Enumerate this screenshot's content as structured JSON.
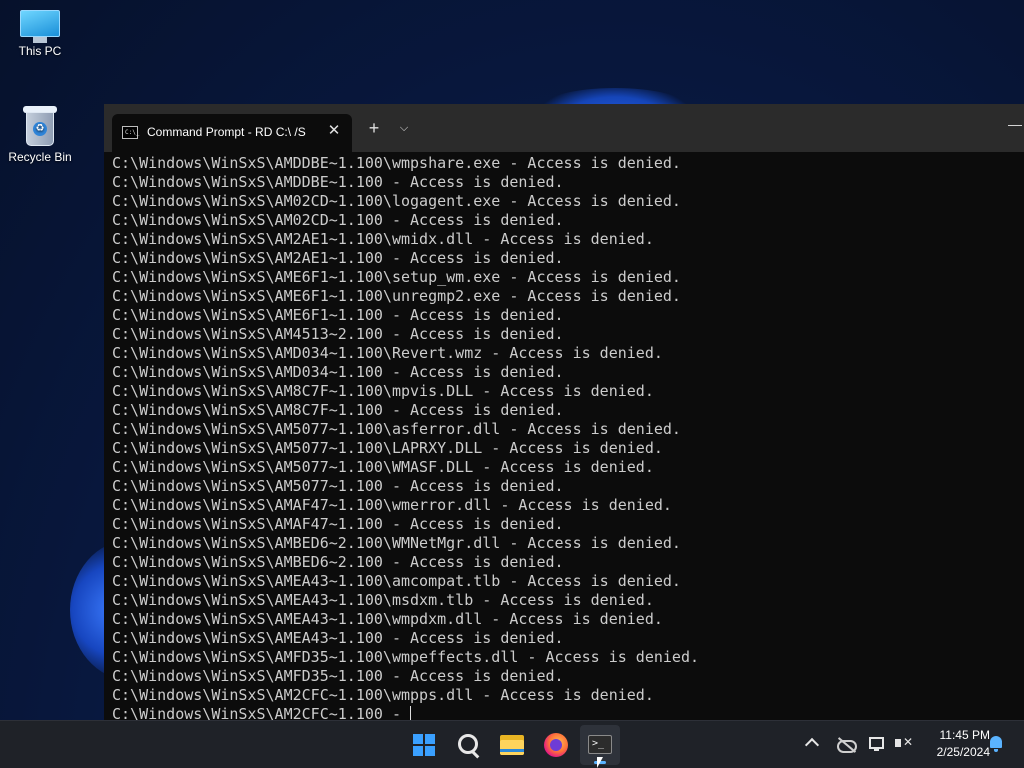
{
  "desktop": {
    "icons": [
      {
        "label": "This PC",
        "icon": "this-pc-icon"
      },
      {
        "label": "Recycle Bin",
        "icon": "recycle-bin-icon"
      }
    ]
  },
  "window": {
    "tab_title": "Command Prompt - RD  C:\\ /S",
    "tab_close": "✕",
    "new_tab": "+",
    "dropdown": "⌵",
    "minimize": "—"
  },
  "console": {
    "lines": [
      "C:\\Windows\\WinSxS\\AMDDBE~1.100\\wmpshare.exe - Access is denied.",
      "C:\\Windows\\WinSxS\\AMDDBE~1.100 - Access is denied.",
      "C:\\Windows\\WinSxS\\AM02CD~1.100\\logagent.exe - Access is denied.",
      "C:\\Windows\\WinSxS\\AM02CD~1.100 - Access is denied.",
      "C:\\Windows\\WinSxS\\AM2AE1~1.100\\wmidx.dll - Access is denied.",
      "C:\\Windows\\WinSxS\\AM2AE1~1.100 - Access is denied.",
      "C:\\Windows\\WinSxS\\AME6F1~1.100\\setup_wm.exe - Access is denied.",
      "C:\\Windows\\WinSxS\\AME6F1~1.100\\unregmp2.exe - Access is denied.",
      "C:\\Windows\\WinSxS\\AME6F1~1.100 - Access is denied.",
      "C:\\Windows\\WinSxS\\AM4513~2.100 - Access is denied.",
      "C:\\Windows\\WinSxS\\AMD034~1.100\\Revert.wmz - Access is denied.",
      "C:\\Windows\\WinSxS\\AMD034~1.100 - Access is denied.",
      "C:\\Windows\\WinSxS\\AM8C7F~1.100\\mpvis.DLL - Access is denied.",
      "C:\\Windows\\WinSxS\\AM8C7F~1.100 - Access is denied.",
      "C:\\Windows\\WinSxS\\AM5077~1.100\\asferror.dll - Access is denied.",
      "C:\\Windows\\WinSxS\\AM5077~1.100\\LAPRXY.DLL - Access is denied.",
      "C:\\Windows\\WinSxS\\AM5077~1.100\\WMASF.DLL - Access is denied.",
      "C:\\Windows\\WinSxS\\AM5077~1.100 - Access is denied.",
      "C:\\Windows\\WinSxS\\AMAF47~1.100\\wmerror.dll - Access is denied.",
      "C:\\Windows\\WinSxS\\AMAF47~1.100 - Access is denied.",
      "C:\\Windows\\WinSxS\\AMBED6~2.100\\WMNetMgr.dll - Access is denied.",
      "C:\\Windows\\WinSxS\\AMBED6~2.100 - Access is denied.",
      "C:\\Windows\\WinSxS\\AMEA43~1.100\\amcompat.tlb - Access is denied.",
      "C:\\Windows\\WinSxS\\AMEA43~1.100\\msdxm.tlb - Access is denied.",
      "C:\\Windows\\WinSxS\\AMEA43~1.100\\wmpdxm.dll - Access is denied.",
      "C:\\Windows\\WinSxS\\AMEA43~1.100 - Access is denied.",
      "C:\\Windows\\WinSxS\\AMFD35~1.100\\wmpeffects.dll - Access is denied.",
      "C:\\Windows\\WinSxS\\AMFD35~1.100 - Access is denied.",
      "C:\\Windows\\WinSxS\\AM2CFC~1.100\\wmpps.dll - Access is denied."
    ],
    "current_line": "C:\\Windows\\WinSxS\\AM2CFC~1.100 - "
  },
  "taskbar": {
    "apps": [
      "start-icon",
      "search-icon",
      "file-explorer-icon",
      "firefox-icon",
      "terminal-icon"
    ],
    "time": "11:45 PM",
    "date": "2/25/2024"
  }
}
